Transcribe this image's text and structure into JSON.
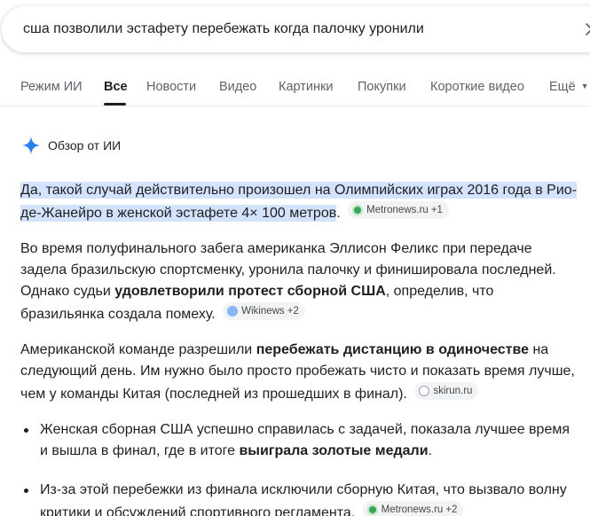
{
  "search": {
    "query": "сша позволили эстафету перебежать когда палочку уронили"
  },
  "tabs": [
    {
      "label": "Режим ИИ"
    },
    {
      "label": "Все"
    },
    {
      "label": "Новости"
    },
    {
      "label": "Видео"
    },
    {
      "label": "Картинки"
    },
    {
      "label": "Покупки"
    },
    {
      "label": "Короткие видео"
    },
    {
      "label": "Ещё"
    }
  ],
  "ai_overview": {
    "label": "Обзор от ИИ",
    "p1": {
      "highlight": "Да, такой случай действительно произошел на Олимпийских играх 2016 года в Рио-де-Жанейро в женской эстафете 4× 100 метров",
      "tail": ".",
      "source": "Metronews.ru",
      "source_count": "+1"
    },
    "p2": {
      "t1": "Во время полуфинального забега американка Эллисон Феликс при передаче задела бразильскую спортсменку, уронила палочку и финишировала последней. Однако судьи ",
      "b1": "удовлетворили протест сборной США",
      "t2": ", определив, что бразильянка создала помеху.",
      "source": "Wikinews",
      "source_count": "+2"
    },
    "p3": {
      "t1": "Американской команде разрешили ",
      "b1": "перебежать дистанцию в одиночестве",
      "t2": " на следующий день. Им нужно было просто пробежать чисто и показать время лучше, чем у команды Китая (последней из прошедших в финал).",
      "source": "skirun.ru"
    },
    "bullets": [
      {
        "t1": "Женская сборная США успешно справилась с задачей, показала лучшее время и вышла в финал, где в итоге ",
        "b1": "выиграла золотые медали",
        "t2": "."
      },
      {
        "t1": "Из-за этой перебежки из финала исключили сборную Китая, что вызвало волну критики и обсуждений спортивного регламента.",
        "source": "Metronews.ru",
        "source_count": "+2"
      }
    ]
  },
  "colors": {
    "highlight": "#d3e3fd",
    "spark_blue": "#4285f4"
  }
}
